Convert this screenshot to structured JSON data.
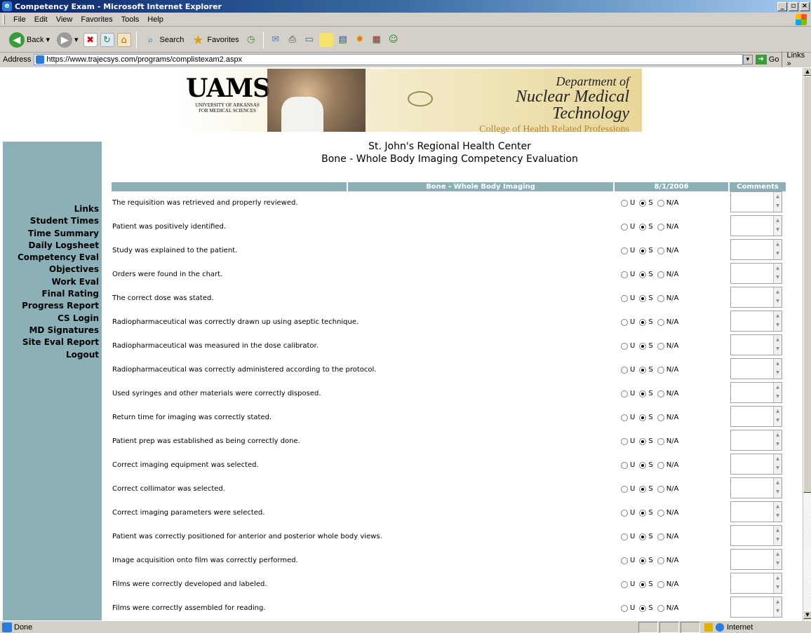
{
  "window": {
    "title": "Competency Exam - Microsoft Internet Explorer"
  },
  "menu": [
    "File",
    "Edit",
    "View",
    "Favorites",
    "Tools",
    "Help"
  ],
  "toolbar": {
    "back": "Back",
    "search": "Search",
    "favorites": "Favorites"
  },
  "address": {
    "label": "Address",
    "url": "https://www.trajecsys.com/programs/complistexam2.aspx",
    "go": "Go",
    "links": "Links"
  },
  "banner": {
    "logo": "UAMS",
    "logo_sub1": "UNIVERSITY OF ARKANSAS",
    "logo_sub2": "FOR MEDICAL SCIENCES",
    "dept1": "Department of",
    "dept2": "Nuclear Medical Technology",
    "dept3": "College of Health Related Professions"
  },
  "heading": {
    "line1": "St. John's Regional Health Center",
    "line2": "Bone - Whole Body Imaging Competency Evaluation"
  },
  "nav": [
    "Links",
    "Student Times",
    "Time Summary",
    "Daily Logsheet",
    "Competency Eval",
    "Objectives",
    "Work Eval",
    "Final Rating",
    "Progress Report",
    "CS Login",
    "MD Signatures",
    "Site Eval Report",
    "Logout"
  ],
  "table": {
    "col_title": "Bone - Whole Body Imaging",
    "col_date": "8/1/2006",
    "col_comments": "Comments",
    "options": [
      "U",
      "S",
      "N/A"
    ],
    "selected": "S",
    "rows": [
      "The requisition was retrieved and properly reviewed.",
      "Patient was positively identified.",
      "Study was explained to the patient.",
      "Orders were found in the chart.",
      "The correct dose was stated.",
      "Radiopharmaceutical was correctly drawn up using aseptic technique.",
      "Radiopharmaceutical was measured in the dose calibrator.",
      "Radiopharmaceutical was correctly administered according to the protocol.",
      "Used syringes and other materials were correctly disposed.",
      "Return time for imaging was correctly stated.",
      "Patient prep was established as being correctly done.",
      "Correct imaging equipment was selected.",
      "Correct collimator was selected.",
      "Correct imaging parameters were selected.",
      "Patient was correctly positioned for anterior and posterior whole body views.",
      "Image acquisition onto film was correctly performed.",
      "Films were correctly developed and labeled.",
      "Films were correctly assembled for reading."
    ]
  },
  "status": {
    "text": "Done",
    "zone": "Internet"
  },
  "colors": {
    "nav_bg": "#8cb0b8",
    "title_bar": "#0a246a"
  }
}
